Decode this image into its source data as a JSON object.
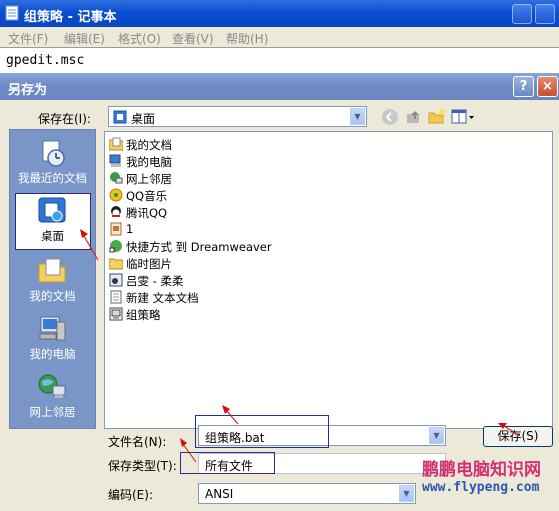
{
  "notepad": {
    "title": "组策略 - 记事本",
    "menu": [
      "文件(F)",
      "编辑(E)",
      "格式(O)",
      "查看(V)",
      "帮助(H)"
    ],
    "content": "gpedit.msc"
  },
  "dialog": {
    "title": "另存为",
    "help_label": "?",
    "close_label": "×",
    "save_in_label": "保存在(I):",
    "save_in_value": "桌面",
    "places": [
      "我最近的文档",
      "桌面",
      "我的文档",
      "我的电脑",
      "网上邻居"
    ],
    "files": [
      {
        "name": "我的文档",
        "icon": "documents-folder-icon"
      },
      {
        "name": "我的电脑",
        "icon": "computer-icon"
      },
      {
        "name": "网上邻居",
        "icon": "network-icon"
      },
      {
        "name": "QQ音乐",
        "icon": "qqmusic-icon"
      },
      {
        "name": "腾讯QQ",
        "icon": "qq-icon"
      },
      {
        "name": "1",
        "icon": "file-icon"
      },
      {
        "name": "快捷方式 到 Dreamweaver",
        "icon": "dreamweaver-shortcut-icon"
      },
      {
        "name": "临时图片",
        "icon": "folder-icon"
      },
      {
        "name": "吕雯 - 柔柔",
        "icon": "audio-file-icon"
      },
      {
        "name": "新建 文本文档",
        "icon": "text-file-icon"
      },
      {
        "name": "组策略",
        "icon": "batch-file-icon"
      }
    ],
    "filename_label": "文件名(N):",
    "filename_value": "组策略.bat",
    "filetype_label": "保存类型(T):",
    "filetype_value": "所有文件",
    "encoding_label": "编码(E):",
    "encoding_value": "ANSI",
    "save_button": "保存(S)"
  },
  "watermark": {
    "line1": "鹏鹏电脑知识网",
    "line2": "www.flypeng.com"
  },
  "colors": {
    "title_active": "#0a4fd0",
    "title_inactive": "#7a96c8",
    "annotation_red": "#d01010"
  }
}
